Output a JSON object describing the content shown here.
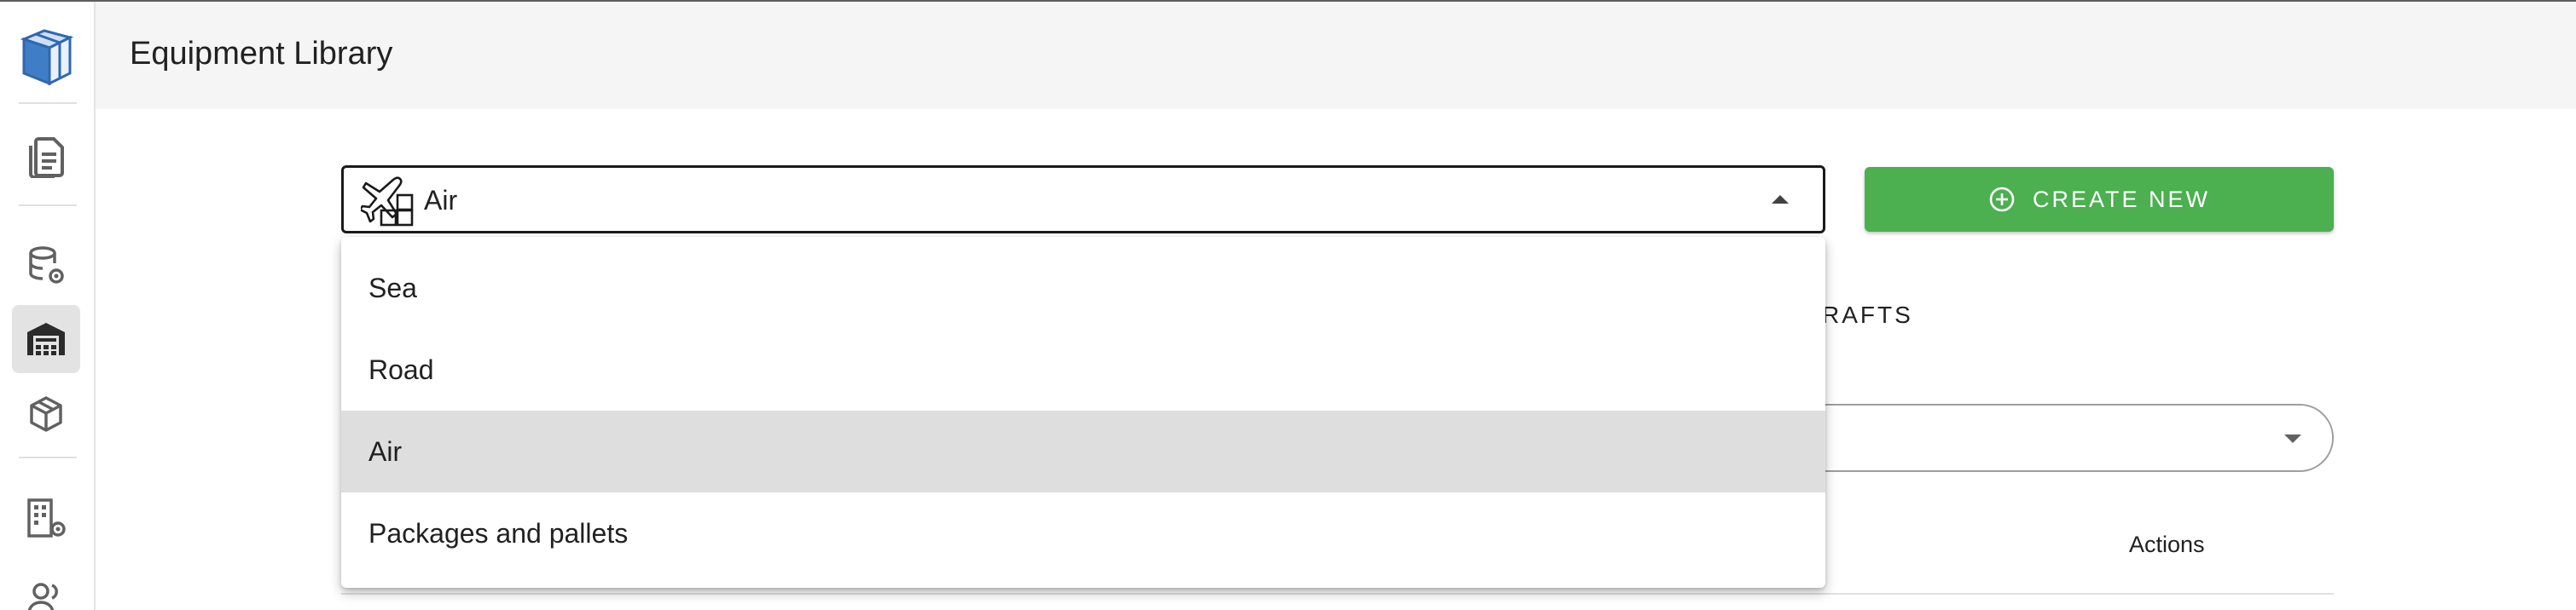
{
  "header": {
    "title": "Equipment Library"
  },
  "sidebar": {
    "items": [
      {
        "icon": "document-icon"
      },
      {
        "icon": "database-settings-icon"
      },
      {
        "icon": "warehouse-icon",
        "active": true
      },
      {
        "icon": "box-icon"
      },
      {
        "icon": "building-settings-icon"
      },
      {
        "icon": "users-icon"
      }
    ]
  },
  "mode_select": {
    "value": "Air",
    "icon": "plane-packages-icon"
  },
  "create_button": {
    "label": "CREATE NEW",
    "color": "#4caf50"
  },
  "background": {
    "tab_partial": "RAFTS",
    "column_actions": "Actions"
  },
  "menu": {
    "options": [
      "Sea",
      "Road",
      "Air",
      "Packages and pallets"
    ],
    "selected": "Air"
  }
}
